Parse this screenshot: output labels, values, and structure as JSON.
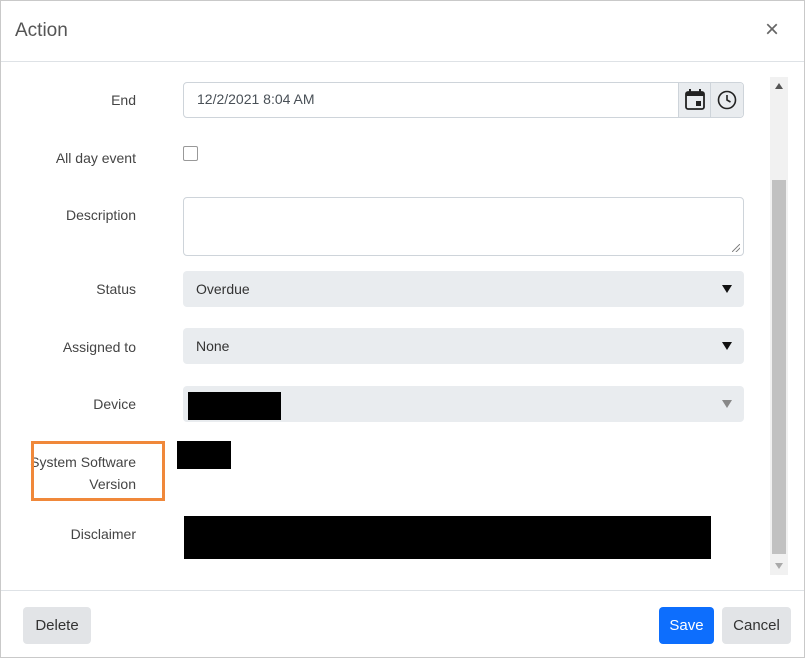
{
  "dialog": {
    "title": "Action",
    "close_symbol": "×"
  },
  "form": {
    "end": {
      "label": "End",
      "value": "12/2/2021 8:04 AM"
    },
    "all_day": {
      "label": "All day event",
      "checked": false
    },
    "description": {
      "label": "Description",
      "value": ""
    },
    "status": {
      "label": "Status",
      "value": "Overdue"
    },
    "assigned_to": {
      "label": "Assigned to",
      "value": "None"
    },
    "device": {
      "label": "Device"
    },
    "system_software_version": {
      "label_line1": "System Software",
      "label_line2": "Version"
    },
    "disclaimer": {
      "label": "Disclaimer"
    }
  },
  "footer": {
    "delete_label": "Delete",
    "save_label": "Save",
    "cancel_label": "Cancel"
  },
  "colors": {
    "primary": "#0d6efd",
    "highlight": "#f0883a",
    "select_bg": "#e9ecef"
  }
}
